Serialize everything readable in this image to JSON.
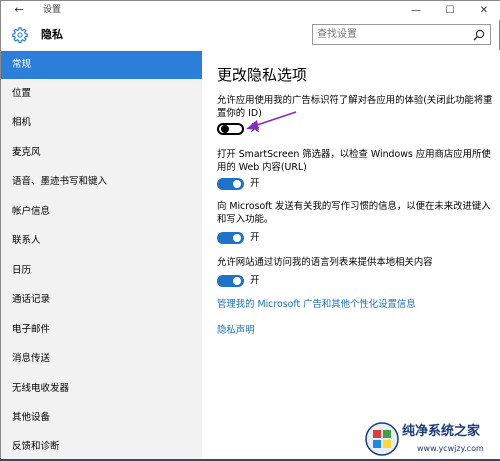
{
  "window": {
    "title": "设置",
    "back_icon": "back-arrow-icon",
    "minimize_glyph": "—",
    "maximize_glyph": "☐",
    "close_glyph": "✕"
  },
  "header": {
    "title": "隐私",
    "icon": "gear-icon",
    "search_placeholder": "查找设置"
  },
  "sidebar": {
    "items": [
      {
        "label": "常规",
        "active": true
      },
      {
        "label": "位置"
      },
      {
        "label": "相机"
      },
      {
        "label": "麦克风"
      },
      {
        "label": "语音、墨迹书写和键入"
      },
      {
        "label": "帐户信息"
      },
      {
        "label": "联系人"
      },
      {
        "label": "日历"
      },
      {
        "label": "通话记录"
      },
      {
        "label": "电子邮件"
      },
      {
        "label": "消息传送"
      },
      {
        "label": "无线电收发器"
      },
      {
        "label": "其他设备"
      },
      {
        "label": "反馈和诊断"
      }
    ]
  },
  "main": {
    "title": "更改隐私选项",
    "settings": [
      {
        "text": "允许应用使用我的广告标识符了解对各应用的体验(关闭此功能将重置你的 ID)",
        "state": "关",
        "on": false
      },
      {
        "text": "打开 SmartScreen 筛选器，以检查 Windows 应用商店应用所使用的 Web 内容(URL)",
        "state": "开",
        "on": true
      },
      {
        "text": "向 Microsoft 发送有关我的写作习惯的信息，以便在未来改进键入和写入功能。",
        "state": "开",
        "on": true
      },
      {
        "text": "允许网站通过访问我的语言列表来提供本地相关内容",
        "state": "开",
        "on": true
      }
    ],
    "links": [
      "管理我的 Microsoft 广告和其他个性化设置信息",
      "隐私声明"
    ]
  },
  "watermark": {
    "text": "纯净系统之家",
    "url": "www.ycwjzy.com"
  },
  "colors": {
    "accent": "#2b7fd9",
    "toggle_on": "#1e73c8",
    "link": "#1a6fc2",
    "sidebar_bg": "#f2f2f2",
    "annotation_arrow": "#8a2bbf"
  }
}
